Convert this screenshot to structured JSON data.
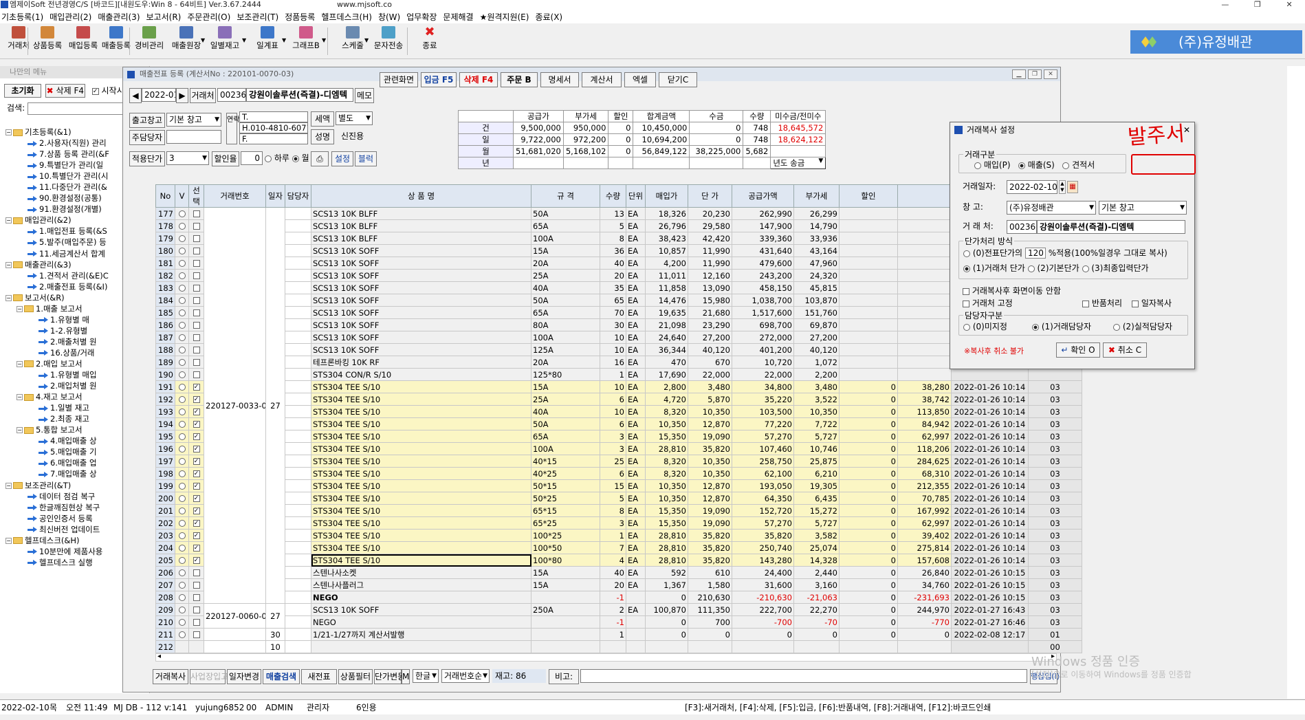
{
  "app": {
    "title": "엠제이Soft 전년경영C/S [바코드][내원도우:Win 8 - 64비트] Ver.3.67.2444",
    "url": "www.mjsoft.co"
  },
  "menubar": [
    "기초등록(1)",
    "매입관리(2)",
    "매출관리(3)",
    "보고서(R)",
    "주문관리(O)",
    "보조관리(T)",
    "정품등록",
    "헬프데스크(H)",
    "창(W)",
    "업무확장",
    "문제해결",
    "★원격지원(E)",
    "종료(X)"
  ],
  "toolbar": {
    "items": [
      "거래처",
      "상품등록",
      "매입등록",
      "매출등록",
      "경비관리",
      "매출원장",
      "일별재고",
      "일계표",
      "그래프B",
      "스케줄",
      "문자전송",
      "종료"
    ],
    "logo_text": "(주)유정배관"
  },
  "left_panel": {
    "title": "나만의 메뉴",
    "reset_btn": "초기화",
    "delete_btn": "삭제 F4",
    "start_chk": "시작시",
    "search_label": "검색:",
    "tree": [
      {
        "level": 0,
        "type": "folder",
        "label": "기초등록(&1)"
      },
      {
        "level": 2,
        "type": "leaf",
        "label": "2.사용자(직원) 관리"
      },
      {
        "level": 2,
        "type": "leaf",
        "label": "7.상품 등록 관리(&F"
      },
      {
        "level": 2,
        "type": "leaf",
        "label": "9.특별단가 관리(일"
      },
      {
        "level": 2,
        "type": "leaf",
        "label": "10.특별단가 관리(시"
      },
      {
        "level": 2,
        "type": "leaf",
        "label": "11.다중단가 관리(&"
      },
      {
        "level": 2,
        "type": "leaf",
        "label": "90.환경설정(공통)"
      },
      {
        "level": 2,
        "type": "leaf",
        "label": "91.환경설정(개별)"
      },
      {
        "level": 0,
        "type": "folder",
        "label": "매입관리(&2)"
      },
      {
        "level": 2,
        "type": "leaf",
        "label": "1.매입전표 등록(&S"
      },
      {
        "level": 2,
        "type": "leaf",
        "label": "5.발주(매입주문) 등"
      },
      {
        "level": 2,
        "type": "leaf",
        "label": "11.세금계산서 합계"
      },
      {
        "level": 0,
        "type": "folder",
        "label": "매출관리(&3)"
      },
      {
        "level": 2,
        "type": "leaf",
        "label": "1.견적서 관리(&E)C"
      },
      {
        "level": 2,
        "type": "leaf",
        "label": "2.매출전표 등록(&I)"
      },
      {
        "level": 0,
        "type": "folder",
        "label": "보고서(&R)"
      },
      {
        "level": 1,
        "type": "folder",
        "label": "1.매출 보고서"
      },
      {
        "level": 3,
        "type": "leaf",
        "label": "1.유형별 매"
      },
      {
        "level": 3,
        "type": "leaf",
        "label": "1-2.유형별"
      },
      {
        "level": 3,
        "type": "leaf",
        "label": "2.매출처별 원"
      },
      {
        "level": 3,
        "type": "leaf",
        "label": "16.상품/거래"
      },
      {
        "level": 1,
        "type": "folder",
        "label": "2.매입 보고서"
      },
      {
        "level": 3,
        "type": "leaf",
        "label": "1.유형별 매입"
      },
      {
        "level": 3,
        "type": "leaf",
        "label": "2.매입처별 원"
      },
      {
        "level": 1,
        "type": "folder",
        "label": "4.재고 보고서"
      },
      {
        "level": 3,
        "type": "leaf",
        "label": "1.일별 재고"
      },
      {
        "level": 3,
        "type": "leaf",
        "label": "2.최종 재고"
      },
      {
        "level": 1,
        "type": "folder",
        "label": "5.통합 보고서"
      },
      {
        "level": 3,
        "type": "leaf",
        "label": "4.매입매출 상"
      },
      {
        "level": 3,
        "type": "leaf",
        "label": "5.매입매출 기"
      },
      {
        "level": 3,
        "type": "leaf",
        "label": "6.매입매출 업"
      },
      {
        "level": 3,
        "type": "leaf",
        "label": "7.매입매출 상"
      },
      {
        "level": 0,
        "type": "folder",
        "label": "보조관리(&T)"
      },
      {
        "level": 2,
        "type": "leaf",
        "label": "데이터 점검 복구"
      },
      {
        "level": 2,
        "type": "leaf",
        "label": "한글깨짐현상 복구"
      },
      {
        "level": 2,
        "type": "leaf",
        "label": "공인인증서 등록"
      },
      {
        "level": 2,
        "type": "leaf",
        "label": "최신버전 업데이트"
      },
      {
        "level": 0,
        "type": "folder",
        "label": "헬프데스크(&H)"
      },
      {
        "level": 2,
        "type": "leaf",
        "label": "10분만에 제품사용"
      },
      {
        "level": 2,
        "type": "leaf",
        "label": "헬프데스크 실행"
      }
    ]
  },
  "main": {
    "title": "매출전표 등록 (계산서No : 220101-0070-03)",
    "month": "2022-01",
    "client_label": "거래처",
    "client_code": "002360",
    "client_name": "강원이솔루션(즉결)-디엠텍",
    "memo_btn": "메모",
    "warehouse_label": "출고창고",
    "warehouse": "기본 창고",
    "manager_label": "주담당자",
    "unit_price_label": "적용단가",
    "unit_price": "3",
    "discount_label": "할인율",
    "discount_value": "0",
    "radio_day": "하루",
    "radio_month": "월",
    "contact_btn": "연락처",
    "tel": "T.",
    "hp": "H.010-4810-6077",
    "fax": "F.",
    "tax_label": "세액",
    "tax_value": "별도",
    "name_label": "성명",
    "credit_label": "신진용",
    "settings_btn": "설정",
    "block_btn": "블럭",
    "action_buttons": [
      "관련화면",
      "입금 F5",
      "삭제 F4",
      "주문 B",
      "명세서",
      "계산서",
      "엑셀",
      "닫기C"
    ],
    "summary": {
      "headers": [
        "",
        "공급가",
        "부가세",
        "할인",
        "합계금액",
        "수금",
        "수량",
        "미수금/전미수"
      ],
      "rows": [
        [
          "건",
          "9,500,000",
          "950,000",
          "0",
          "10,450,000",
          "0",
          "748",
          "18,645,572"
        ],
        [
          "일",
          "9,722,000",
          "972,200",
          "0",
          "10,694,200",
          "0",
          "748",
          "18,624,122"
        ],
        [
          "월",
          "51,681,020",
          "5,168,102",
          "0",
          "56,849,122",
          "38,225,000",
          "5,682",
          ""
        ],
        [
          "년",
          "",
          "",
          "",
          "",
          "",
          "",
          "년도 송금"
        ]
      ]
    },
    "grid": {
      "headers": [
        "No",
        "V",
        "선택",
        "거래번호",
        "일자",
        "담당자",
        "상 품 명",
        "규 격",
        "수량",
        "단위",
        "매입가",
        "단 가",
        "공급가액",
        "부가세",
        "할인",
        "",
        "",
        ""
      ],
      "group1_no": "220127-0033-03",
      "group1_day": "27",
      "group2_no": "220127-0060-03",
      "group2_day": "27",
      "rows": [
        [
          "177",
          "SCS13 10K BLFF",
          "50A",
          "13",
          "EA",
          "18,326",
          "20,230",
          "262,990",
          "26,299",
          "",
          "",
          "",
          ""
        ],
        [
          "178",
          "SCS13 10K BLFF",
          "65A",
          "5",
          "EA",
          "26,796",
          "29,580",
          "147,900",
          "14,790",
          "",
          "",
          "",
          ""
        ],
        [
          "179",
          "SCS13 10K BLFF",
          "100A",
          "8",
          "EA",
          "38,423",
          "42,420",
          "339,360",
          "33,936",
          "",
          "",
          "",
          ""
        ],
        [
          "180",
          "SCS13 10K SOFF",
          "15A",
          "36",
          "EA",
          "10,857",
          "11,990",
          "431,640",
          "43,164",
          "",
          "",
          "",
          ""
        ],
        [
          "181",
          "SCS13 10K SOFF",
          "20A",
          "40",
          "EA",
          "4,200",
          "11,990",
          "479,600",
          "47,960",
          "",
          "",
          "",
          ""
        ],
        [
          "182",
          "SCS13 10K SOFF",
          "25A",
          "20",
          "EA",
          "11,011",
          "12,160",
          "243,200",
          "24,320",
          "",
          "",
          "",
          ""
        ],
        [
          "183",
          "SCS13 10K SOFF",
          "40A",
          "35",
          "EA",
          "11,858",
          "13,090",
          "458,150",
          "45,815",
          "",
          "",
          "",
          ""
        ],
        [
          "184",
          "SCS13 10K SOFF",
          "50A",
          "65",
          "EA",
          "14,476",
          "15,980",
          "1,038,700",
          "103,870",
          "",
          "",
          "",
          ""
        ],
        [
          "185",
          "SCS13 10K SOFF",
          "65A",
          "70",
          "EA",
          "19,635",
          "21,680",
          "1,517,600",
          "151,760",
          "",
          "",
          "",
          ""
        ],
        [
          "186",
          "SCS13 10K SOFF",
          "80A",
          "30",
          "EA",
          "21,098",
          "23,290",
          "698,700",
          "69,870",
          "",
          "",
          "",
          ""
        ],
        [
          "187",
          "SCS13 10K SOFF",
          "100A",
          "10",
          "EA",
          "24,640",
          "27,200",
          "272,000",
          "27,200",
          "",
          "",
          "",
          ""
        ],
        [
          "188",
          "SCS13 10K SOFF",
          "125A",
          "10",
          "EA",
          "36,344",
          "40,120",
          "401,200",
          "40,120",
          "",
          "",
          "",
          ""
        ],
        [
          "189",
          "테프론바킹 10K RF",
          "20A",
          "16",
          "EA",
          "470",
          "670",
          "10,720",
          "1,072",
          "",
          "",
          "",
          ""
        ],
        [
          "190",
          "STS304 CON/R S/10",
          "125*80",
          "1",
          "EA",
          "17,690",
          "22,000",
          "22,000",
          "2,200",
          "",
          "",
          "",
          ""
        ],
        [
          "191",
          "STS304 TEE S/10",
          "15A",
          "10",
          "EA",
          "2,800",
          "3,480",
          "34,800",
          "3,480",
          "0",
          "38,280",
          "2022-01-26 10:14",
          "03"
        ],
        [
          "192",
          "STS304 TEE S/10",
          "25A",
          "6",
          "EA",
          "4,720",
          "5,870",
          "35,220",
          "3,522",
          "0",
          "38,742",
          "2022-01-26 10:14",
          "03"
        ],
        [
          "193",
          "STS304 TEE S/10",
          "40A",
          "10",
          "EA",
          "8,320",
          "10,350",
          "103,500",
          "10,350",
          "0",
          "113,850",
          "2022-01-26 10:14",
          "03"
        ],
        [
          "194",
          "STS304 TEE S/10",
          "50A",
          "6",
          "EA",
          "10,350",
          "12,870",
          "77,220",
          "7,722",
          "0",
          "84,942",
          "2022-01-26 10:14",
          "03"
        ],
        [
          "195",
          "STS304 TEE S/10",
          "65A",
          "3",
          "EA",
          "15,350",
          "19,090",
          "57,270",
          "5,727",
          "0",
          "62,997",
          "2022-01-26 10:14",
          "03"
        ],
        [
          "196",
          "STS304 TEE S/10",
          "100A",
          "3",
          "EA",
          "28,810",
          "35,820",
          "107,460",
          "10,746",
          "0",
          "118,206",
          "2022-01-26 10:14",
          "03"
        ],
        [
          "197",
          "STS304 TEE S/10",
          "40*15",
          "25",
          "EA",
          "8,320",
          "10,350",
          "258,750",
          "25,875",
          "0",
          "284,625",
          "2022-01-26 10:14",
          "03"
        ],
        [
          "198",
          "STS304 TEE S/10",
          "40*25",
          "6",
          "EA",
          "8,320",
          "10,350",
          "62,100",
          "6,210",
          "0",
          "68,310",
          "2022-01-26 10:14",
          "03"
        ],
        [
          "199",
          "STS304 TEE S/10",
          "50*15",
          "15",
          "EA",
          "10,350",
          "12,870",
          "193,050",
          "19,305",
          "0",
          "212,355",
          "2022-01-26 10:14",
          "03"
        ],
        [
          "200",
          "STS304 TEE S/10",
          "50*25",
          "5",
          "EA",
          "10,350",
          "12,870",
          "64,350",
          "6,435",
          "0",
          "70,785",
          "2022-01-26 10:14",
          "03"
        ],
        [
          "201",
          "STS304 TEE S/10",
          "65*15",
          "8",
          "EA",
          "15,350",
          "19,090",
          "152,720",
          "15,272",
          "0",
          "167,992",
          "2022-01-26 10:14",
          "03"
        ],
        [
          "202",
          "STS304 TEE S/10",
          "65*25",
          "3",
          "EA",
          "15,350",
          "19,090",
          "57,270",
          "5,727",
          "0",
          "62,997",
          "2022-01-26 10:14",
          "03"
        ],
        [
          "203",
          "STS304 TEE S/10",
          "100*25",
          "1",
          "EA",
          "28,810",
          "35,820",
          "35,820",
          "3,582",
          "0",
          "39,402",
          "2022-01-26 10:14",
          "03"
        ],
        [
          "204",
          "STS304 TEE S/10",
          "100*50",
          "7",
          "EA",
          "28,810",
          "35,820",
          "250,740",
          "25,074",
          "0",
          "275,814",
          "2022-01-26 10:14",
          "03"
        ],
        [
          "205",
          "STS304 TEE S/10",
          "100*80",
          "4",
          "EA",
          "28,810",
          "35,820",
          "143,280",
          "14,328",
          "0",
          "157,608",
          "2022-01-26 10:14",
          "03"
        ],
        [
          "206",
          "스텐나사소켓",
          "15A",
          "40",
          "EA",
          "592",
          "610",
          "24,400",
          "2,440",
          "0",
          "26,840",
          "2022-01-26 10:15",
          "03"
        ],
        [
          "207",
          "스텐나사플러그",
          "15A",
          "20",
          "EA",
          "1,367",
          "1,580",
          "31,600",
          "3,160",
          "0",
          "34,760",
          "2022-01-26 10:15",
          "03"
        ],
        [
          "208",
          "NEGO",
          "",
          "-1",
          "",
          "0",
          "210,630",
          "-210,630",
          "-21,063",
          "0",
          "-231,693",
          "2022-01-26 10:15",
          "03"
        ],
        [
          "209",
          "SCS13 10K SOFF",
          "250A",
          "2",
          "EA",
          "100,870",
          "111,350",
          "222,700",
          "22,270",
          "0",
          "244,970",
          "2022-01-27 16:43",
          "03"
        ],
        [
          "210",
          "NEGO",
          "",
          "-1",
          "",
          "0",
          "700",
          "-700",
          "-70",
          "0",
          "-770",
          "2022-01-27 16:46",
          "03"
        ],
        [
          "211",
          "1/21-1/27까지 계산서발행",
          "",
          "1",
          "",
          "0",
          "0",
          "0",
          "0",
          "0",
          "0",
          "2022-02-08 12:17",
          "01"
        ],
        [
          "212",
          "",
          "",
          "",
          "",
          "",
          "",
          "",
          "",
          "",
          "",
          "",
          "00"
        ]
      ],
      "row211_day": "30",
      "row212_day": "10"
    },
    "bottom": {
      "buttons": [
        "거래복사",
        "사업장입고",
        "일자변경",
        "매출검색",
        "새전표",
        "상품필터",
        "단가변동"
      ],
      "m_label": "M",
      "lang": "한글",
      "sort": "거래번호순",
      "stock": "재고: 86",
      "note_label": "비고:",
      "row_insert": "행삽입(I)"
    }
  },
  "dialog": {
    "title": "거래복사 설정",
    "group_type": "거래구분",
    "type_options": [
      "매입(P)",
      "매출(S)",
      "견적서"
    ],
    "annotation": "발주서",
    "date_label": "거래일자:",
    "date_value": "2022-02-10",
    "warehouse_label": "창  고:",
    "warehouse_value": "(주)유정배관",
    "warehouse_value2": "기본 창고",
    "client_label": "거 래 처:",
    "client_code": "002360",
    "client_name": "강원이솔루션(즉결)-디엠텍",
    "price_group": "단가처리 방식",
    "price_opt0_a": "(0)전표단가의",
    "price_pct": "120",
    "price_opt0_b": "%적용(100%일경우 그대로 복사)",
    "price_opt1": "(1)거래처 단가",
    "price_opt2": "(2)기본단가",
    "price_opt3": "(3)최종입력단가",
    "chk_nomove": "거래복사후 화면이동 안함",
    "chk_fix": "거래처 고정",
    "chk_return": "반품처리",
    "chk_date": "일자복사",
    "mgr_group": "담당자구분",
    "mgr_opt0": "(0)미지정",
    "mgr_opt1": "(1)거래담당자",
    "mgr_opt2": "(2)실적담당자",
    "warning": "※복사후 취소 불가",
    "ok_btn": "확인 O",
    "cancel_btn": "취소 C"
  },
  "statusbar": {
    "date": "2022-02-10",
    "weekday": "목",
    "time": "오전 11:49",
    "db": "MJ DB - 112 v:141",
    "user": "yujung6852",
    "code": "00",
    "role": "ADMIN",
    "level": "관리자",
    "count": "6인용",
    "hotkeys": "[F3]:새거래처, [F4]:삭제, [F5]:입금, [F6]:반품내역, [F8]:거래내역, [F12]:바코드인쇄"
  },
  "watermark": {
    "line1": "Windows 정품 인증",
    "line2": "[설정]으로 이동하여 Windows를 정품 인증합"
  },
  "colors": {
    "selected_row": "#fbf6c4",
    "grid_header": "#dfe7f2",
    "negative": "#e00000",
    "logo_bg": "#4a8ad8",
    "annotation": "#e00000"
  }
}
